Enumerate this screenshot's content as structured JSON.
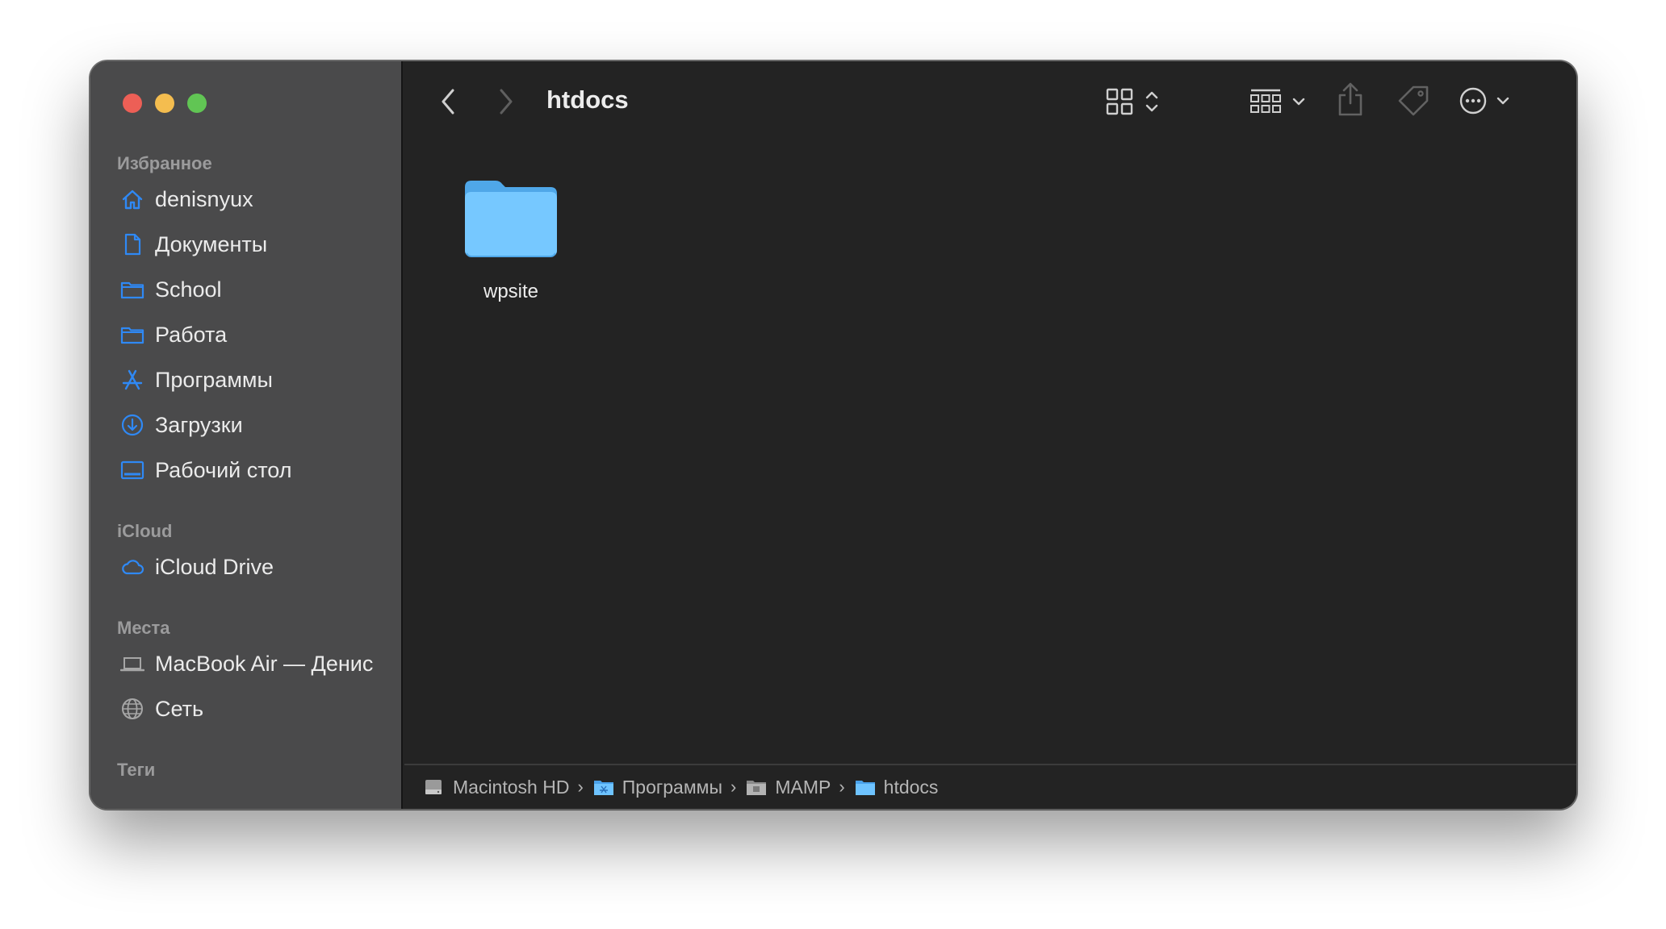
{
  "window": {
    "title": "htdocs"
  },
  "sidebar": {
    "sections": {
      "favorites": "Избранное",
      "icloud": "iCloud",
      "places": "Места",
      "tags": "Теги"
    },
    "favorites": [
      {
        "label": "denisnyux",
        "icon": "home-icon"
      },
      {
        "label": "Документы",
        "icon": "document-icon"
      },
      {
        "label": "School",
        "icon": "folder-icon"
      },
      {
        "label": "Работа",
        "icon": "folder-icon"
      },
      {
        "label": "Программы",
        "icon": "applications-icon"
      },
      {
        "label": "Загрузки",
        "icon": "downloads-icon"
      },
      {
        "label": "Рабочий стол",
        "icon": "desktop-icon"
      }
    ],
    "icloud": [
      {
        "label": "iCloud Drive",
        "icon": "cloud-icon"
      }
    ],
    "places": [
      {
        "label": "MacBook Air — Денис",
        "icon": "laptop-icon"
      },
      {
        "label": "Сеть",
        "icon": "network-icon"
      }
    ]
  },
  "content": {
    "items": [
      {
        "name": "wpsite",
        "icon": "folder-icon"
      }
    ]
  },
  "pathbar": {
    "crumbs": [
      {
        "label": "Macintosh HD",
        "icon": "disk-icon"
      },
      {
        "label": "Программы",
        "icon": "applications-folder-icon"
      },
      {
        "label": "MAMP",
        "icon": "folder-icon"
      },
      {
        "label": "htdocs",
        "icon": "folder-icon"
      }
    ]
  },
  "colors": {
    "accent": "#2f89f5",
    "folder": "#6ec3ff",
    "sidebar_bg": "#4a4a4b",
    "content_bg": "#232323"
  }
}
